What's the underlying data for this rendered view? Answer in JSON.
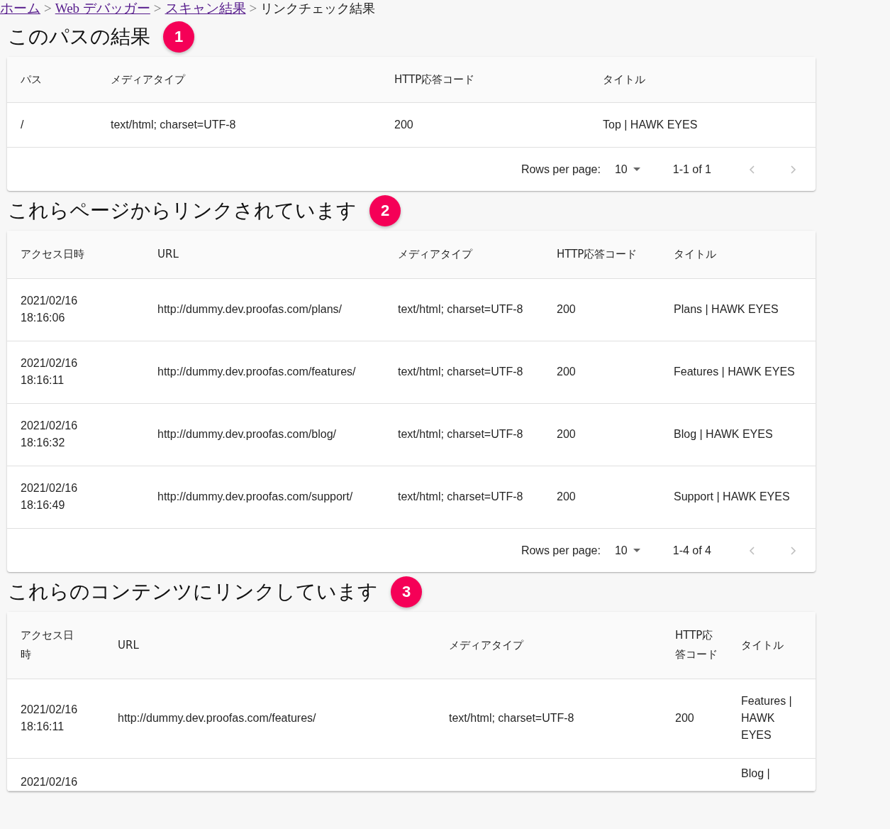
{
  "breadcrumb": [
    {
      "label": "ホーム",
      "kind": "link"
    },
    {
      "label": ">",
      "kind": "separator"
    },
    {
      "label": "Web デバッガー",
      "kind": "link"
    },
    {
      "label": ">",
      "kind": "separator"
    },
    {
      "label": "スキャン結果",
      "kind": "link"
    },
    {
      "label": ">",
      "kind": "separator"
    },
    {
      "label": "リンクチェック結果",
      "kind": "current"
    }
  ],
  "sections": [
    {
      "title": "このパスの結果",
      "badge": "1",
      "columns": [
        "パス",
        "メディアタイプ",
        "HTTP応答コード",
        "タイトル"
      ],
      "rows": [
        [
          "/",
          "text/html; charset=UTF-8",
          "200",
          "Top | HAWK EYES"
        ]
      ],
      "pagination": {
        "rows_per_page_label": "Rows per page:",
        "rows_per_page": "10",
        "range": "1-1 of 1",
        "prev_disabled": true,
        "next_disabled": true
      }
    },
    {
      "title": "これらページからリンクされています",
      "badge": "2",
      "columns": [
        "アクセス日時",
        "URL",
        "メディアタイプ",
        "HTTP応答コード",
        "タイトル"
      ],
      "rows": [
        [
          "2021/02/16 18:16:06",
          "http://dummy.dev.proofas.com/plans/",
          "text/html; charset=UTF-8",
          "200",
          "Plans | HAWK EYES"
        ],
        [
          "2021/02/16 18:16:11",
          "http://dummy.dev.proofas.com/features/",
          "text/html; charset=UTF-8",
          "200",
          "Features | HAWK EYES"
        ],
        [
          "2021/02/16 18:16:32",
          "http://dummy.dev.proofas.com/blog/",
          "text/html; charset=UTF-8",
          "200",
          "Blog | HAWK EYES"
        ],
        [
          "2021/02/16 18:16:49",
          "http://dummy.dev.proofas.com/support/",
          "text/html; charset=UTF-8",
          "200",
          "Support | HAWK EYES"
        ]
      ],
      "pagination": {
        "rows_per_page_label": "Rows per page:",
        "rows_per_page": "10",
        "range": "1-4 of 4",
        "prev_disabled": true,
        "next_disabled": true
      }
    },
    {
      "title": "これらのコンテンツにリンクしています",
      "badge": "3",
      "columns": [
        "アクセス日時",
        "URL",
        "メディアタイプ",
        "HTTP応答コード",
        "タイトル"
      ],
      "rows": [
        [
          "2021/02/16 18:16:11",
          "http://dummy.dev.proofas.com/features/",
          "text/html; charset=UTF-8",
          "200",
          "Features | HAWK EYES"
        ],
        [
          "2021/02/16",
          null,
          null,
          null,
          "Blog |"
        ]
      ]
    }
  ]
}
